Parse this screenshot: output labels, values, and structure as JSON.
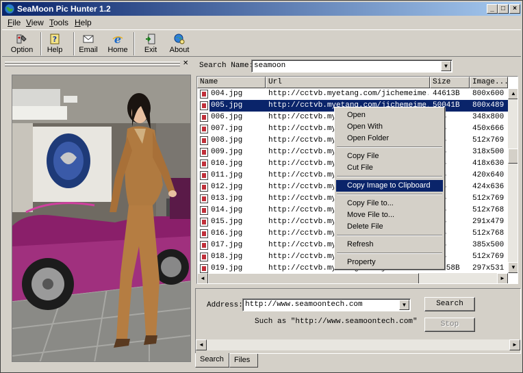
{
  "window": {
    "title": "SeaMoon Pic Hunter 1.2"
  },
  "menu": [
    {
      "label": "File",
      "u": "F",
      "rest": "ile"
    },
    {
      "label": "View",
      "u": "V",
      "rest": "iew"
    },
    {
      "label": "Tools",
      "u": "T",
      "rest": "ools"
    },
    {
      "label": "Help",
      "u": "H",
      "rest": "elp"
    }
  ],
  "toolbar": {
    "option": "Option",
    "help": "Help",
    "email": "Email",
    "home": "Home",
    "exit": "Exit",
    "about": "About"
  },
  "search": {
    "label": "Search Name:",
    "value": "seamoon"
  },
  "list": {
    "columns": [
      "Name",
      "Url",
      "Size",
      "Image..."
    ],
    "rows": [
      {
        "name": "004.jpg",
        "url": "http://cctvb.myetang.com/jichemeime...",
        "size": "44613B",
        "dim": "800x600"
      },
      {
        "name": "005.jpg",
        "url": "http://cctvb.myetang.com/jichemeime...",
        "size": "50041B",
        "dim": "800x489"
      },
      {
        "name": "006.jpg",
        "url": "http://cctvb.mye",
        "size": "87B",
        "dim": "348x800"
      },
      {
        "name": "007.jpg",
        "url": "http://cctvb.mye",
        "size": "89B",
        "dim": "450x666"
      },
      {
        "name": "008.jpg",
        "url": "http://cctvb.mye",
        "size": "51B",
        "dim": "512x769"
      },
      {
        "name": "009.jpg",
        "url": "http://cctvb.mye",
        "size": "17B",
        "dim": "318x500"
      },
      {
        "name": "010.jpg",
        "url": "http://cctvb.mye",
        "size": "81B",
        "dim": "418x630"
      },
      {
        "name": "011.jpg",
        "url": "http://cctvb.mye",
        "size": "33B",
        "dim": "420x640"
      },
      {
        "name": "012.jpg",
        "url": "http://cctvb.mye",
        "size": "39B",
        "dim": "424x636"
      },
      {
        "name": "013.jpg",
        "url": "http://cctvb.mye",
        "size": "94B",
        "dim": "512x769"
      },
      {
        "name": "014.jpg",
        "url": "http://cctvb.mye",
        "size": "59B",
        "dim": "512x768"
      },
      {
        "name": "015.jpg",
        "url": "http://cctvb.mye",
        "size": "31B",
        "dim": "291x479"
      },
      {
        "name": "016.jpg",
        "url": "http://cctvb.mye",
        "size": "04B",
        "dim": "512x768"
      },
      {
        "name": "017.jpg",
        "url": "http://cctvb.mye",
        "size": "89B",
        "dim": "385x500"
      },
      {
        "name": "018.jpg",
        "url": "http://cctvb.mye",
        "size": "82B",
        "dim": "512x769"
      },
      {
        "name": "019.jpg",
        "url": "http://cctvb.myetang.com/jichemeime...",
        "size": "28558B",
        "dim": "297x531"
      }
    ]
  },
  "context_menu": {
    "open": "Open",
    "open_with": "Open With",
    "open_folder": "Open Folder",
    "copy_file": "Copy File",
    "cut_file": "Cut File",
    "copy_image": "Copy Image to Clipboard",
    "copy_file_to": "Copy File to...",
    "move_file_to": "Move File to...",
    "delete_file": "Delete File",
    "refresh": "Refresh",
    "property": "Property"
  },
  "address": {
    "label": "Address:",
    "value": "http://www.seamoontech.com",
    "hint": "Such as \"http://www.seamoontech.com\"",
    "search_button": "Search",
    "stop_button": "Stop"
  },
  "tabs": [
    "Search",
    "Files"
  ],
  "colors": {
    "title_start": "#0a246a",
    "title_end": "#a6caf0",
    "selection": "#0a246a",
    "face": "#d4d0c8"
  }
}
